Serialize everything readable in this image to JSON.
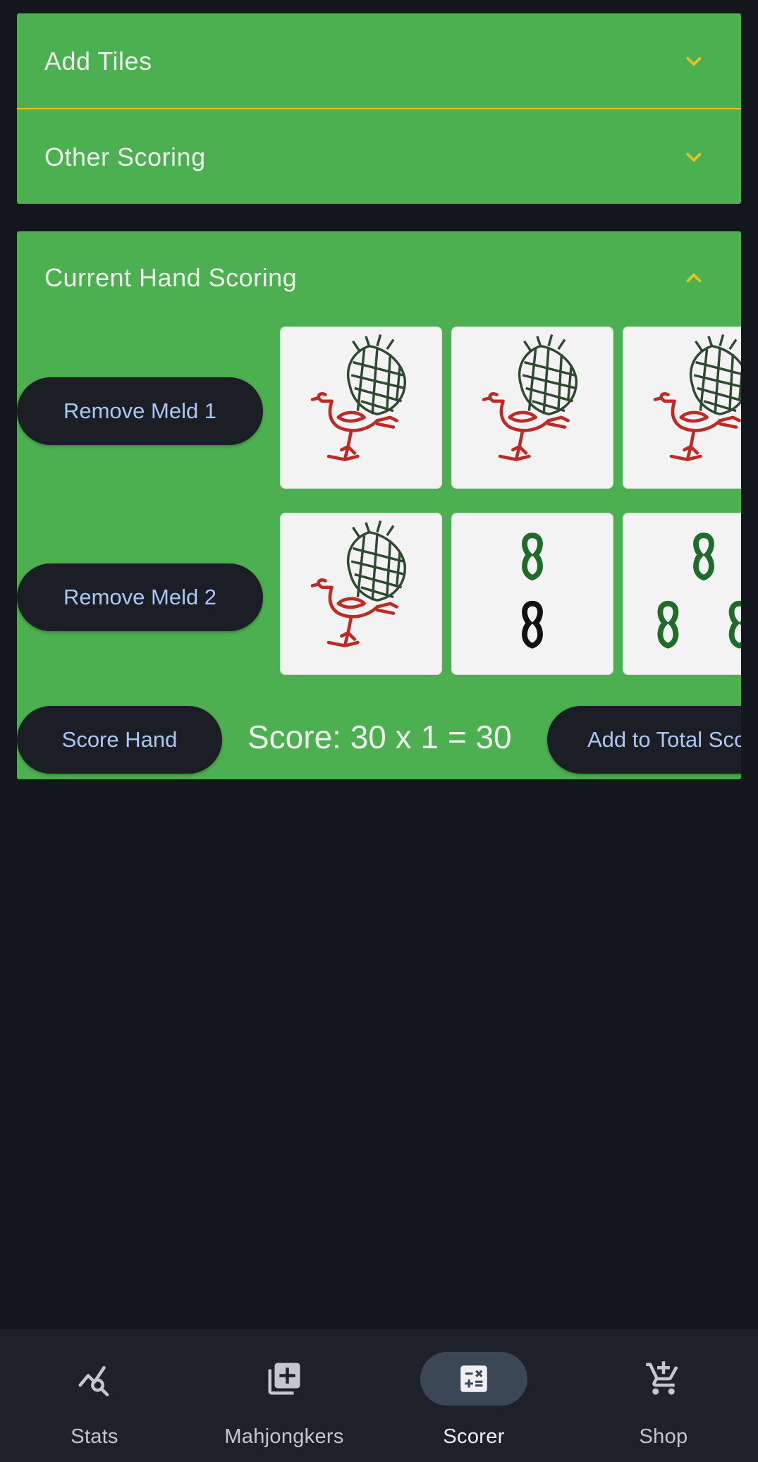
{
  "accordions": {
    "add_tiles": "Add Tiles",
    "other_scoring": "Other Scoring",
    "current_hand": "Current Hand Scoring"
  },
  "colors": {
    "panel_green": "#4caf50",
    "chevron_gold": "#e5c21e",
    "pill_dark": "#1b1e24",
    "pill_text": "#a9c8f3",
    "background": "#13161c"
  },
  "melds": [
    {
      "remove_label": "Remove Meld 1",
      "tiles": [
        "bird-tile",
        "bird-tile",
        "bird-tile"
      ]
    },
    {
      "remove_label": "Remove Meld 2",
      "tiles": [
        "bird-tile",
        "two-bamboo-tile",
        "three-bamboo-tile"
      ]
    }
  ],
  "actions": {
    "score_hand": "Score Hand",
    "score_text": "Score: 30 x 1 = 30",
    "add_to_total": "Add to Total Score"
  },
  "nav": {
    "items": [
      {
        "label": "Stats",
        "icon": "stats-search-icon"
      },
      {
        "label": "Mahjongkers",
        "icon": "add-library-icon"
      },
      {
        "label": "Scorer",
        "icon": "calculator-icon",
        "active": true
      },
      {
        "label": "Shop",
        "icon": "cart-add-icon"
      }
    ]
  }
}
